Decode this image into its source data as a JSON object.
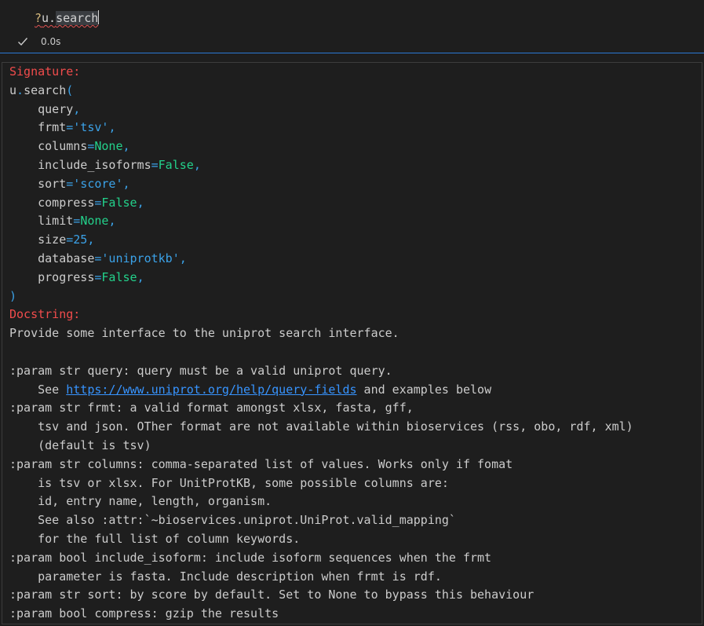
{
  "input_cell": {
    "code_prefix": "?",
    "code_body": "u.",
    "code_selected": "search"
  },
  "status": {
    "icon": "check-icon",
    "time": "0.0s"
  },
  "signature": {
    "header": "Signature:",
    "func_open": "u.search(",
    "params": [
      {
        "name": "query",
        "eq": "",
        "value": "",
        "type": "none",
        "comma": ","
      },
      {
        "name": "frmt",
        "eq": "=",
        "value": "'tsv'",
        "type": "str",
        "comma": ","
      },
      {
        "name": "columns",
        "eq": "=",
        "value": "None",
        "type": "kw",
        "comma": ","
      },
      {
        "name": "include_isoforms",
        "eq": "=",
        "value": "False",
        "type": "kw",
        "comma": ","
      },
      {
        "name": "sort",
        "eq": "=",
        "value": "'score'",
        "type": "str",
        "comma": ","
      },
      {
        "name": "compress",
        "eq": "=",
        "value": "False",
        "type": "kw",
        "comma": ","
      },
      {
        "name": "limit",
        "eq": "=",
        "value": "None",
        "type": "kw",
        "comma": ","
      },
      {
        "name": "size",
        "eq": "=",
        "value": "25",
        "type": "num",
        "comma": ","
      },
      {
        "name": "database",
        "eq": "=",
        "value": "'uniprotkb'",
        "type": "str",
        "comma": ","
      },
      {
        "name": "progress",
        "eq": "=",
        "value": "False",
        "type": "kw",
        "comma": ","
      }
    ],
    "func_close": ")"
  },
  "docstring": {
    "header": "Docstring:",
    "summary": "Provide some interface to the uniprot search interface.",
    "lines": [
      "",
      ":param str query: query must be a valid uniprot query.",
      "    See ",
      ":param str frmt: a valid format amongst xlsx, fasta, gff,",
      "    tsv and json. OTher format are not available within bioservices (rss, obo, rdf, xml)",
      "    (default is tsv)",
      ":param str columns: comma-separated list of values. Works only if fomat",
      "    is tsv or xlsx. For UnitProtKB, some possible columns are:",
      "    id, entry name, length, organism.",
      "    See also :attr:`~bioservices.uniprot.UniProt.valid_mapping`",
      "    for the full list of column keywords.",
      ":param bool include_isoform: include isoform sequences when the frmt",
      "    parameter is fasta. Include description when frmt is rdf.",
      ":param str sort: by score by default. Set to None to bypass this behaviour",
      ":param bool compress: gzip the results"
    ],
    "link_text": "https://www.uniprot.org/help/query-fields",
    "link_suffix": " and examples below"
  }
}
